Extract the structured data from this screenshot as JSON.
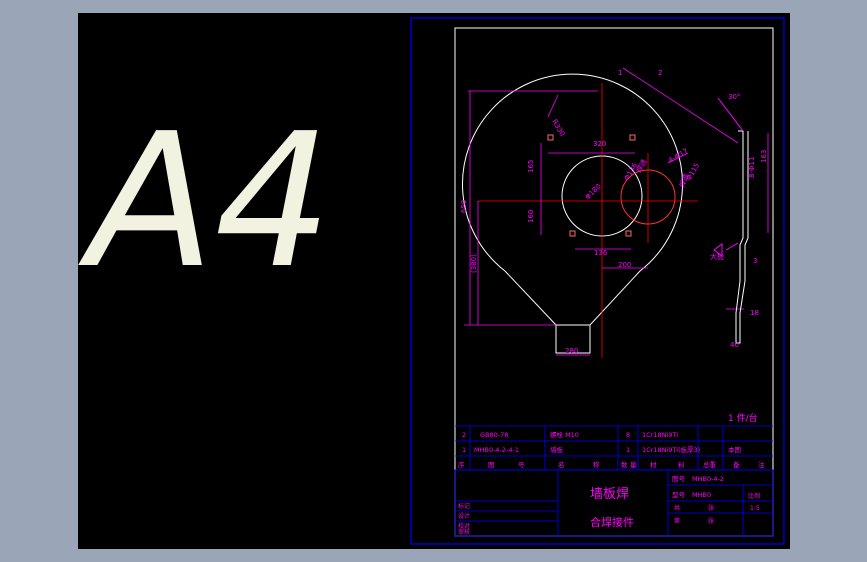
{
  "sheet": {
    "big_label": "A4",
    "balloons": [
      "1",
      "2"
    ],
    "quantity_note": "1 件/台"
  },
  "dims": {
    "r330": "R330",
    "d320": "320",
    "d165": "165",
    "d160": "160",
    "d136": "136",
    "d200": "200",
    "dia180": "Φ180",
    "dia136": "Φ136",
    "d4phi17": "4-Φ17",
    "dia115": "Φ115",
    "weld_a": "焊透",
    "weld_b": "焊透",
    "d650": "650",
    "d380": "(380)",
    "d280": "280",
    "angle": "30°",
    "d8phi11": "8-Φ11",
    "d163": "163",
    "side_note": "大抛",
    "d3": "3",
    "d18": "18",
    "d40": "40"
  },
  "bom": {
    "rows": [
      {
        "no": "2",
        "code": "GB80-78",
        "name": "螺栓 M10",
        "qty": "8",
        "material": "1Cr18Ni9Ti",
        "note": ""
      },
      {
        "no": "1",
        "code": "MHB0-4-2-4-1",
        "name": "墙板",
        "qty": "1",
        "material": "1Cr18Ni9Ti(板厚3)",
        "note": "本图"
      }
    ],
    "header": [
      "序",
      "图",
      "号",
      "名",
      "称",
      "数",
      "量",
      "材",
      "料",
      "总重",
      "备",
      "注"
    ]
  },
  "title_block": {
    "drawing_title": "墙板焊",
    "drawing_subtitle": "合焊接件",
    "code_label": "图号",
    "code_value": "MHB0-4-2",
    "type_label": "型号",
    "type_value": "MHB0",
    "left_rows": [
      "标记",
      "设计",
      "校对",
      "审核"
    ],
    "right_labels": [
      "共",
      "张",
      "第",
      "张"
    ],
    "ratio_label": "比例",
    "ratio_value": "1:5"
  },
  "colors": {
    "frame": "#0000ff",
    "line": "#ffffff",
    "dim": "#ff00ff",
    "center": "#ff0000",
    "table": "#0000ff"
  }
}
